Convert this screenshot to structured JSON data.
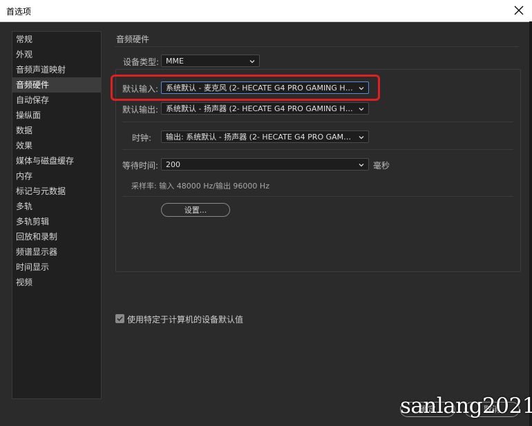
{
  "window": {
    "title": "首选项",
    "close_icon": "close-icon"
  },
  "sidebar": {
    "items": [
      {
        "label": "常规"
      },
      {
        "label": "外观"
      },
      {
        "label": "音频声道映射"
      },
      {
        "label": "音频硬件"
      },
      {
        "label": "自动保存"
      },
      {
        "label": "操纵面"
      },
      {
        "label": "数据"
      },
      {
        "label": "效果"
      },
      {
        "label": "媒体与磁盘缓存"
      },
      {
        "label": "内存"
      },
      {
        "label": "标记与元数据"
      },
      {
        "label": "多轨"
      },
      {
        "label": "多轨剪辑"
      },
      {
        "label": "回放和录制"
      },
      {
        "label": "频谱显示器"
      },
      {
        "label": "时间显示"
      },
      {
        "label": "视频"
      }
    ],
    "active": "音频硬件"
  },
  "main": {
    "section_title": "音频硬件",
    "device_type": {
      "label": "设备类型:",
      "value": "MME"
    },
    "default_input": {
      "label": "默认输入:",
      "value": "系统默认 - 麦克风 (2- HECATE G4 PRO GAMING HEA..."
    },
    "default_output": {
      "label": "默认输出:",
      "value": "系统默认 - 扬声器 (2- HECATE G4 PRO GAMING HEA..."
    },
    "clock": {
      "label": "时钟:",
      "value": "输出: 系统默认 - 扬声器 (2- HECATE G4 PRO GAMING..."
    },
    "latency": {
      "label": "等待时间:",
      "value": "200",
      "unit": "毫秒"
    },
    "sample_rate": "采样率: 输入 48000 Hz/输出 96000 Hz",
    "settings_button": "设置...",
    "use_machine_default": {
      "label": "使用特定于计算机的设备默认值",
      "checked": true
    }
  },
  "footer": {
    "ok_label": "确定",
    "cancel_label": "取消"
  },
  "watermark": "sanlang2021",
  "colors": {
    "highlight": "#e02020",
    "background": "#2b2b2b",
    "focus": "#5a8bd8"
  }
}
